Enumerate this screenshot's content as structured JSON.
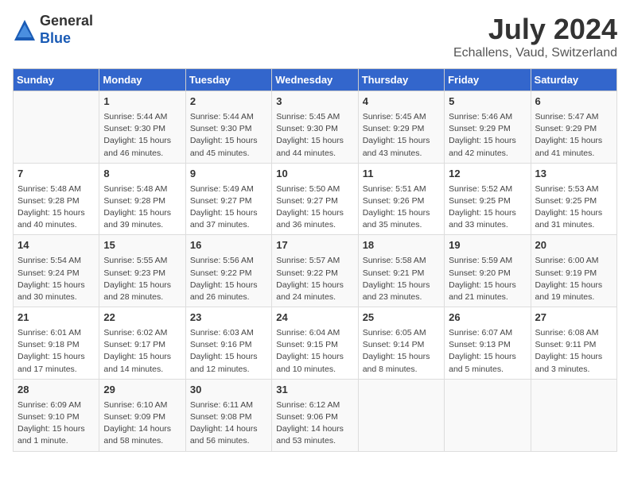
{
  "header": {
    "logo_general": "General",
    "logo_blue": "Blue",
    "month_year": "July 2024",
    "location": "Echallens, Vaud, Switzerland"
  },
  "calendar": {
    "days_of_week": [
      "Sunday",
      "Monday",
      "Tuesday",
      "Wednesday",
      "Thursday",
      "Friday",
      "Saturday"
    ],
    "weeks": [
      [
        {
          "day": "",
          "info": ""
        },
        {
          "day": "1",
          "info": "Sunrise: 5:44 AM\nSunset: 9:30 PM\nDaylight: 15 hours\nand 46 minutes."
        },
        {
          "day": "2",
          "info": "Sunrise: 5:44 AM\nSunset: 9:30 PM\nDaylight: 15 hours\nand 45 minutes."
        },
        {
          "day": "3",
          "info": "Sunrise: 5:45 AM\nSunset: 9:30 PM\nDaylight: 15 hours\nand 44 minutes."
        },
        {
          "day": "4",
          "info": "Sunrise: 5:45 AM\nSunset: 9:29 PM\nDaylight: 15 hours\nand 43 minutes."
        },
        {
          "day": "5",
          "info": "Sunrise: 5:46 AM\nSunset: 9:29 PM\nDaylight: 15 hours\nand 42 minutes."
        },
        {
          "day": "6",
          "info": "Sunrise: 5:47 AM\nSunset: 9:29 PM\nDaylight: 15 hours\nand 41 minutes."
        }
      ],
      [
        {
          "day": "7",
          "info": "Sunrise: 5:48 AM\nSunset: 9:28 PM\nDaylight: 15 hours\nand 40 minutes."
        },
        {
          "day": "8",
          "info": "Sunrise: 5:48 AM\nSunset: 9:28 PM\nDaylight: 15 hours\nand 39 minutes."
        },
        {
          "day": "9",
          "info": "Sunrise: 5:49 AM\nSunset: 9:27 PM\nDaylight: 15 hours\nand 37 minutes."
        },
        {
          "day": "10",
          "info": "Sunrise: 5:50 AM\nSunset: 9:27 PM\nDaylight: 15 hours\nand 36 minutes."
        },
        {
          "day": "11",
          "info": "Sunrise: 5:51 AM\nSunset: 9:26 PM\nDaylight: 15 hours\nand 35 minutes."
        },
        {
          "day": "12",
          "info": "Sunrise: 5:52 AM\nSunset: 9:25 PM\nDaylight: 15 hours\nand 33 minutes."
        },
        {
          "day": "13",
          "info": "Sunrise: 5:53 AM\nSunset: 9:25 PM\nDaylight: 15 hours\nand 31 minutes."
        }
      ],
      [
        {
          "day": "14",
          "info": "Sunrise: 5:54 AM\nSunset: 9:24 PM\nDaylight: 15 hours\nand 30 minutes."
        },
        {
          "day": "15",
          "info": "Sunrise: 5:55 AM\nSunset: 9:23 PM\nDaylight: 15 hours\nand 28 minutes."
        },
        {
          "day": "16",
          "info": "Sunrise: 5:56 AM\nSunset: 9:22 PM\nDaylight: 15 hours\nand 26 minutes."
        },
        {
          "day": "17",
          "info": "Sunrise: 5:57 AM\nSunset: 9:22 PM\nDaylight: 15 hours\nand 24 minutes."
        },
        {
          "day": "18",
          "info": "Sunrise: 5:58 AM\nSunset: 9:21 PM\nDaylight: 15 hours\nand 23 minutes."
        },
        {
          "day": "19",
          "info": "Sunrise: 5:59 AM\nSunset: 9:20 PM\nDaylight: 15 hours\nand 21 minutes."
        },
        {
          "day": "20",
          "info": "Sunrise: 6:00 AM\nSunset: 9:19 PM\nDaylight: 15 hours\nand 19 minutes."
        }
      ],
      [
        {
          "day": "21",
          "info": "Sunrise: 6:01 AM\nSunset: 9:18 PM\nDaylight: 15 hours\nand 17 minutes."
        },
        {
          "day": "22",
          "info": "Sunrise: 6:02 AM\nSunset: 9:17 PM\nDaylight: 15 hours\nand 14 minutes."
        },
        {
          "day": "23",
          "info": "Sunrise: 6:03 AM\nSunset: 9:16 PM\nDaylight: 15 hours\nand 12 minutes."
        },
        {
          "day": "24",
          "info": "Sunrise: 6:04 AM\nSunset: 9:15 PM\nDaylight: 15 hours\nand 10 minutes."
        },
        {
          "day": "25",
          "info": "Sunrise: 6:05 AM\nSunset: 9:14 PM\nDaylight: 15 hours\nand 8 minutes."
        },
        {
          "day": "26",
          "info": "Sunrise: 6:07 AM\nSunset: 9:13 PM\nDaylight: 15 hours\nand 5 minutes."
        },
        {
          "day": "27",
          "info": "Sunrise: 6:08 AM\nSunset: 9:11 PM\nDaylight: 15 hours\nand 3 minutes."
        }
      ],
      [
        {
          "day": "28",
          "info": "Sunrise: 6:09 AM\nSunset: 9:10 PM\nDaylight: 15 hours\nand 1 minute."
        },
        {
          "day": "29",
          "info": "Sunrise: 6:10 AM\nSunset: 9:09 PM\nDaylight: 14 hours\nand 58 minutes."
        },
        {
          "day": "30",
          "info": "Sunrise: 6:11 AM\nSunset: 9:08 PM\nDaylight: 14 hours\nand 56 minutes."
        },
        {
          "day": "31",
          "info": "Sunrise: 6:12 AM\nSunset: 9:06 PM\nDaylight: 14 hours\nand 53 minutes."
        },
        {
          "day": "",
          "info": ""
        },
        {
          "day": "",
          "info": ""
        },
        {
          "day": "",
          "info": ""
        }
      ]
    ]
  }
}
